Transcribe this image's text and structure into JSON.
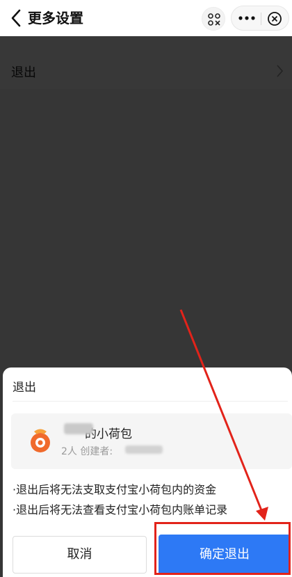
{
  "header": {
    "title": "更多设置",
    "icons": {
      "back": "chevron-left-icon",
      "scan": "scan-icon",
      "more": "more-dots-icon",
      "close": "close-circle-icon"
    }
  },
  "settings": {
    "exit_row_label": "退出"
  },
  "dialog": {
    "title": "退出",
    "group": {
      "name_suffix": "的小荷包",
      "meta_prefix": "2人 创建者: "
    },
    "notes": [
      "·退出后将无法支取支付宝小荷包内的资金",
      "·退出后将无法查看支付宝小荷包内账单记录"
    ],
    "cancel_label": "取消",
    "confirm_label": "确定退出"
  },
  "colors": {
    "confirm_blue": "#2d79f5",
    "annotation_red": "#e2231a",
    "logo_orange": "#f06a2c"
  }
}
